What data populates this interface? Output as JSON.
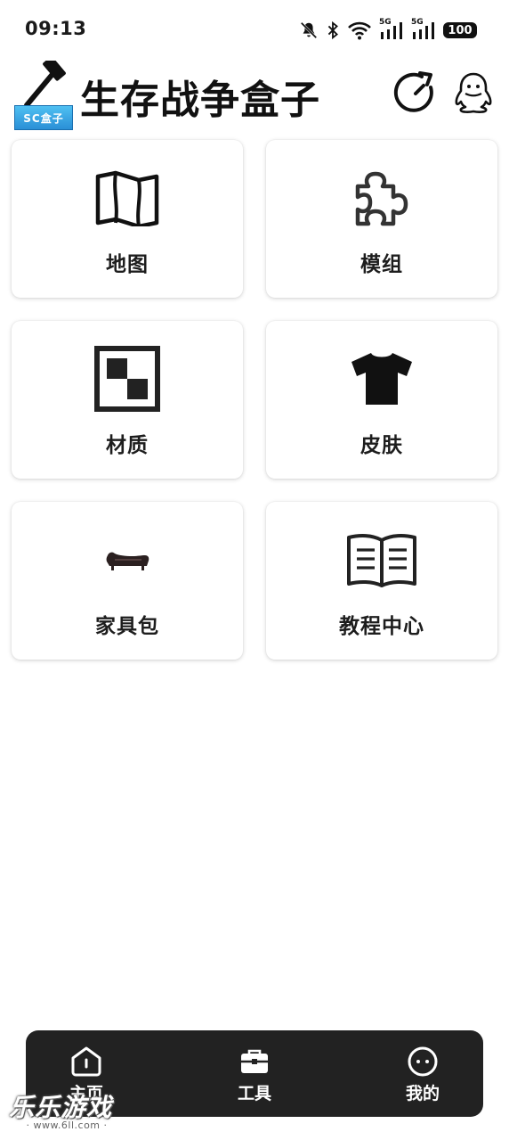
{
  "status_bar": {
    "time": "09:13",
    "net1": "5G",
    "net2": "5G",
    "battery": "100"
  },
  "header": {
    "title": "生存战争盒子",
    "logo_badge": "SC盒子",
    "refresh_icon": "refresh-icon",
    "qq_icon": "qq-icon"
  },
  "cards": [
    {
      "label": "地图",
      "icon": "map-icon"
    },
    {
      "label": "模组",
      "icon": "puzzle-icon"
    },
    {
      "label": "材质",
      "icon": "texture-icon"
    },
    {
      "label": "皮肤",
      "icon": "tshirt-icon"
    },
    {
      "label": "家具包",
      "icon": "sofa-icon"
    },
    {
      "label": "教程中心",
      "icon": "book-icon"
    }
  ],
  "bottom_nav": {
    "items": [
      {
        "label": "主页",
        "icon": "home-icon"
      },
      {
        "label": "工具",
        "icon": "toolbox-icon"
      },
      {
        "label": "我的",
        "icon": "face-icon"
      }
    ]
  },
  "watermark": {
    "main": "乐乐游戏",
    "sub": "· www.6ll.com ·"
  },
  "colors": {
    "background": "#ffffff",
    "nav_background": "#222222",
    "text": "#1d1d1d"
  }
}
